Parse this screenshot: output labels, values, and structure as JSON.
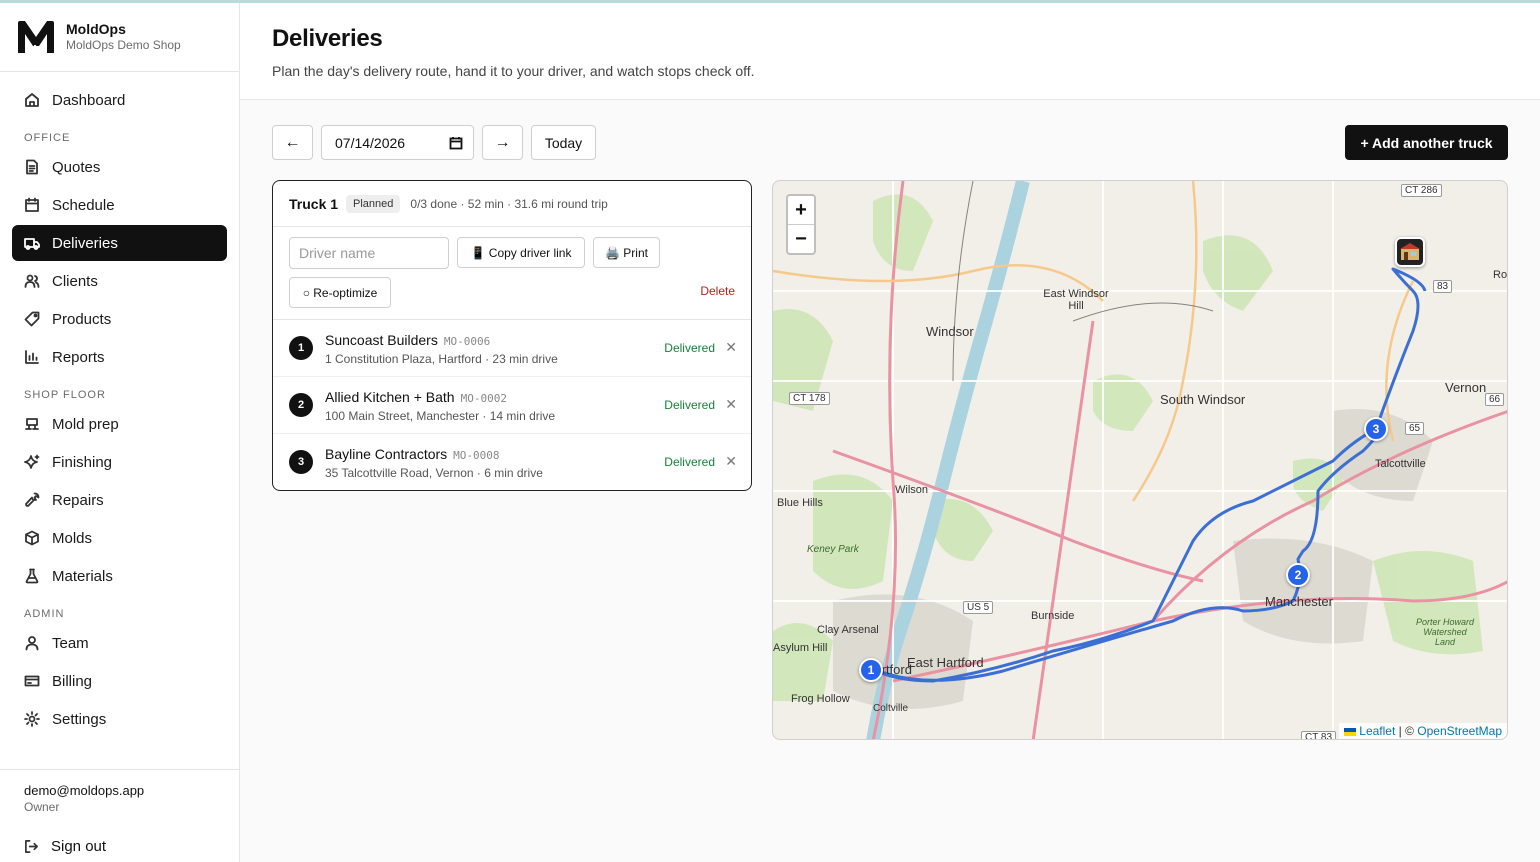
{
  "brand": {
    "name": "MoldOps",
    "shop": "MoldOps Demo Shop"
  },
  "sidebar": {
    "dashboard": "Dashboard",
    "sections": {
      "office": "OFFICE",
      "shop_floor": "SHOP FLOOR",
      "admin": "ADMIN"
    },
    "office": [
      "Quotes",
      "Schedule",
      "Deliveries",
      "Clients",
      "Products",
      "Reports"
    ],
    "shop_floor": [
      "Mold prep",
      "Finishing",
      "Repairs",
      "Molds",
      "Materials"
    ],
    "admin": [
      "Team",
      "Billing",
      "Settings"
    ],
    "active": "Deliveries"
  },
  "user": {
    "email": "demo@moldops.app",
    "role": "Owner",
    "signout": "Sign out"
  },
  "header": {
    "title": "Deliveries",
    "subtitle": "Plan the day's delivery route, hand it to your driver, and watch stops check off."
  },
  "controls": {
    "prev": "←",
    "date": "07/14/2026",
    "next": "→",
    "today": "Today",
    "add_truck": "+ Add another truck"
  },
  "truck": {
    "name": "Truck 1",
    "status": "Planned",
    "meta": "0/3 done · 52 min · 31.6 mi round trip",
    "driver_placeholder": "Driver name",
    "copy_link": "📱 Copy driver link",
    "print": "🖨️ Print",
    "reoptimize": "○ Re-optimize",
    "delete": "Delete",
    "stops": [
      {
        "num": "1",
        "name": "Suncoast Builders",
        "code": "MO-0006",
        "detail": "1 Constitution Plaza, Hartford · 23 min drive",
        "status": "Delivered"
      },
      {
        "num": "2",
        "name": "Allied Kitchen + Bath",
        "code": "MO-0002",
        "detail": "100 Main Street, Manchester · 14 min drive",
        "status": "Delivered"
      },
      {
        "num": "3",
        "name": "Bayline Contractors",
        "code": "MO-0008",
        "detail": "35 Talcottville Road, Vernon · 6 min drive",
        "status": "Delivered"
      }
    ]
  },
  "map": {
    "zoom_in": "+",
    "zoom_out": "−",
    "attribution_leaflet": "Leaflet",
    "attribution_sep": " | © ",
    "attribution_osm": "OpenStreetMap",
    "markers": [
      "1",
      "2",
      "3"
    ],
    "places": [
      "Windsor",
      "East Windsor Hill",
      "South Windsor",
      "Vernon",
      "Talcottville",
      "Wilson",
      "Blue Hills",
      "Keney Park",
      "Burnside",
      "Manchester",
      "East Hartford",
      "Hartford",
      "Clay Arsenal",
      "Asylum Hill",
      "Frog Hollow",
      "Coltville",
      "Porter Howard Watershed Land",
      "Ro"
    ],
    "shields": [
      "CT 286",
      "83",
      "CT 178",
      "US 5",
      "CT 83",
      "66",
      "65"
    ],
    "route_color": "#3b6fd4"
  }
}
